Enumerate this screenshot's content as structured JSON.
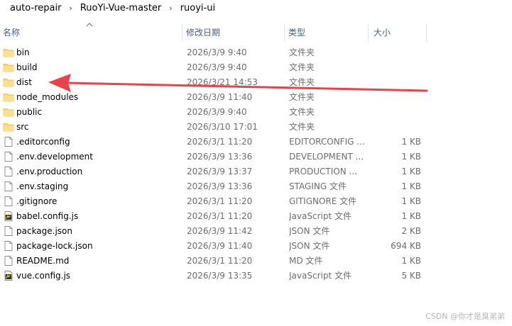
{
  "breadcrumb": [
    "auto-repair",
    "RuoYi-Vue-master",
    "ruoyi-ui"
  ],
  "breadcrumb_separator": "›",
  "columns": {
    "name": "名称",
    "date": "修改日期",
    "type": "类型",
    "size": "大小"
  },
  "files": [
    {
      "name": "bin",
      "date": "2026/3/9 9:40",
      "type": "文件夹",
      "size": "",
      "icon": "folder-icon"
    },
    {
      "name": "build",
      "date": "2026/3/9 9:40",
      "type": "文件夹",
      "size": "",
      "icon": "folder-icon"
    },
    {
      "name": "dist",
      "date": "2026/3/21 14:53",
      "type": "文件夹",
      "size": "",
      "icon": "folder-icon"
    },
    {
      "name": "node_modules",
      "date": "2026/3/9 11:40",
      "type": "文件夹",
      "size": "",
      "icon": "folder-icon"
    },
    {
      "name": "public",
      "date": "2026/3/9 9:40",
      "type": "文件夹",
      "size": "",
      "icon": "folder-icon"
    },
    {
      "name": "src",
      "date": "2026/3/10 17:01",
      "type": "文件夹",
      "size": "",
      "icon": "folder-icon"
    },
    {
      "name": ".editorconfig",
      "date": "2026/3/1 11:20",
      "type": "EDITORCONFIG ...",
      "size": "1 KB",
      "icon": "file-icon"
    },
    {
      "name": ".env.development",
      "date": "2026/3/9 13:36",
      "type": "DEVELOPMENT ...",
      "size": "1 KB",
      "icon": "file-icon"
    },
    {
      "name": ".env.production",
      "date": "2026/3/9 13:37",
      "type": "PRODUCTION ...",
      "size": "1 KB",
      "icon": "file-icon"
    },
    {
      "name": ".env.staging",
      "date": "2026/3/9 13:36",
      "type": "STAGING 文件",
      "size": "1 KB",
      "icon": "file-icon"
    },
    {
      "name": ".gitignore",
      "date": "2026/3/1 11:20",
      "type": "GITIGNORE 文件",
      "size": "1 KB",
      "icon": "file-icon"
    },
    {
      "name": "babel.config.js",
      "date": "2026/3/1 11:20",
      "type": "JavaScript 文件",
      "size": "1 KB",
      "icon": "js-file-icon"
    },
    {
      "name": "package.json",
      "date": "2026/3/9 11:42",
      "type": "JSON 文件",
      "size": "2 KB",
      "icon": "file-icon"
    },
    {
      "name": "package-lock.json",
      "date": "2026/3/9 11:40",
      "type": "JSON 文件",
      "size": "694 KB",
      "icon": "file-icon"
    },
    {
      "name": "README.md",
      "date": "2026/3/1 11:20",
      "type": "MD 文件",
      "size": "1 KB",
      "icon": "file-icon"
    },
    {
      "name": "vue.config.js",
      "date": "2026/3/9 13:35",
      "type": "JavaScript 文件",
      "size": "5 KB",
      "icon": "js-file-icon"
    }
  ],
  "watermark": "CSDN @你才是臭弟弟",
  "colors": {
    "arrow": "#e8434b",
    "header_text": "#4c607a",
    "folder": "#f8d775"
  }
}
